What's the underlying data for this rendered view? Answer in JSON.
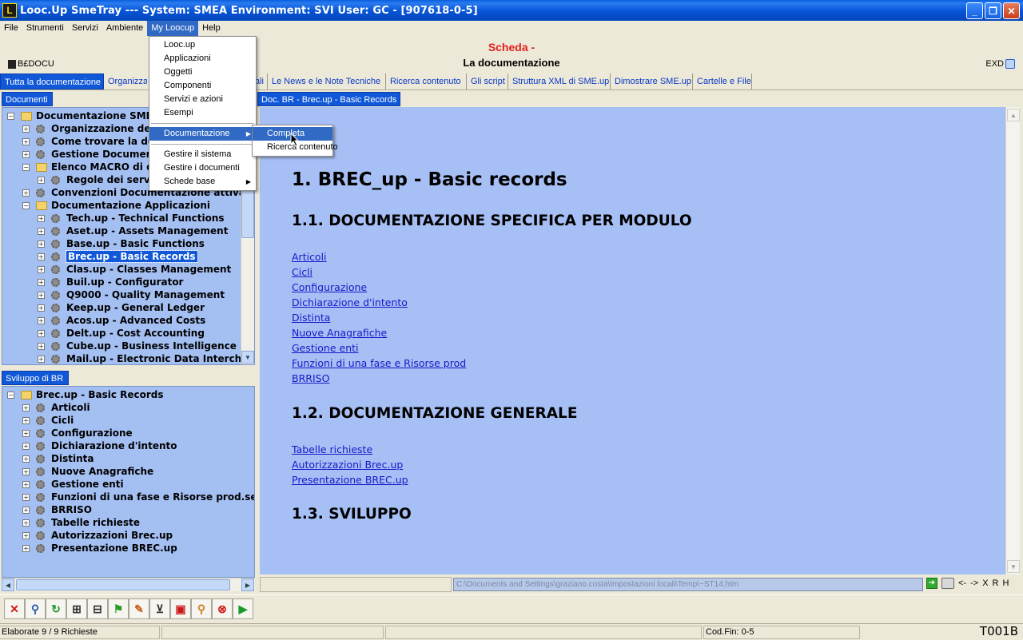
{
  "window": {
    "title": "Looc.Up SmeTray --- System: SMEA Environment: SVI User: GC - [907618-0-5]",
    "app_icon": "L",
    "minimize": "_",
    "restore": "❐",
    "close": "✕"
  },
  "menubar": [
    "File",
    "Strumenti",
    "Servizi",
    "Ambiente",
    "My Loocup",
    "Help"
  ],
  "header": {
    "scheda": "Scheda -",
    "title": "La documentazione",
    "left_code": "B£DOCU",
    "right_code": "EXD"
  },
  "tabs": [
    "Tutta la documentazione",
    "Organizzazione",
    "ali",
    "Le News e le Note Tecniche",
    "Ricerca contenuto",
    "Gli script",
    "Struttura XML di SME.up",
    "Dimostrare SME.up",
    "Cartelle e File"
  ],
  "docs_panel": {
    "tab": "Documenti",
    "items": [
      {
        "label": "Documentazione SME.up",
        "exp": "−",
        "icon": "folder",
        "level": 0
      },
      {
        "label": "Organizzazione della d",
        "exp": "+",
        "icon": "gear",
        "level": 1
      },
      {
        "label": "Come trovare la docu",
        "exp": "+",
        "icon": "gear",
        "level": 1
      },
      {
        "label": "Gestione Documentaz",
        "exp": "+",
        "icon": "gear",
        "level": 1
      },
      {
        "label": "Elenco MACRO di doc",
        "exp": "−",
        "icon": "folder",
        "level": 1
      },
      {
        "label": "Regole dei servizi",
        "exp": "+",
        "icon": "gear",
        "level": 2
      },
      {
        "label": "Convenzioni Documentazione attiva",
        "exp": "+",
        "icon": "gear",
        "level": 1
      },
      {
        "label": "Documentazione Applicazioni",
        "exp": "−",
        "icon": "folder",
        "level": 1
      },
      {
        "label": "Tech.up - Technical Functions",
        "exp": "+",
        "icon": "gear",
        "level": 2
      },
      {
        "label": "Aset.up - Assets Management",
        "exp": "+",
        "icon": "gear",
        "level": 2
      },
      {
        "label": "Base.up - Basic Functions",
        "exp": "+",
        "icon": "gear",
        "level": 2
      },
      {
        "label": "Brec.up - Basic Records",
        "exp": "+",
        "icon": "gear",
        "level": 2,
        "selected": true
      },
      {
        "label": "Clas.up - Classes Management",
        "exp": "+",
        "icon": "gear",
        "level": 2
      },
      {
        "label": "Buil.up - Configurator",
        "exp": "+",
        "icon": "gear",
        "level": 2
      },
      {
        "label": "Q9000 - Quality Management",
        "exp": "+",
        "icon": "gear",
        "level": 2
      },
      {
        "label": "Keep.up - General Ledger",
        "exp": "+",
        "icon": "gear",
        "level": 2
      },
      {
        "label": "Acos.up - Advanced Costs",
        "exp": "+",
        "icon": "gear",
        "level": 2
      },
      {
        "label": "Delt.up - Cost Accounting",
        "exp": "+",
        "icon": "gear",
        "level": 2
      },
      {
        "label": "Cube.up - Business Intelligence",
        "exp": "+",
        "icon": "gear",
        "level": 2
      },
      {
        "label": "Mail.up - Electronic Data Interchange",
        "exp": "+",
        "icon": "gear",
        "level": 2
      }
    ]
  },
  "dev_panel": {
    "tab": "Sviluppo di BR",
    "items": [
      {
        "label": "Brec.up - Basic Records",
        "exp": "−",
        "icon": "folder",
        "level": 0
      },
      {
        "label": "Articoli",
        "exp": "+",
        "icon": "gear",
        "level": 1
      },
      {
        "label": "Cicli",
        "exp": "+",
        "icon": "gear",
        "level": 1
      },
      {
        "label": "Configurazione",
        "exp": "+",
        "icon": "gear",
        "level": 1
      },
      {
        "label": "Dichiarazione d'intento",
        "exp": "+",
        "icon": "gear",
        "level": 1
      },
      {
        "label": "Distinta",
        "exp": "+",
        "icon": "gear",
        "level": 1
      },
      {
        "label": "Nuove Anagrafiche",
        "exp": "+",
        "icon": "gear",
        "level": 1
      },
      {
        "label": "Gestione enti",
        "exp": "+",
        "icon": "gear",
        "level": 1
      },
      {
        "label": "Funzioni di una fase e Risorse prod.secondar",
        "exp": "+",
        "icon": "gear",
        "level": 1
      },
      {
        "label": "BRRISO",
        "exp": "+",
        "icon": "gear",
        "level": 1
      },
      {
        "label": "Tabelle richieste",
        "exp": "+",
        "icon": "gear",
        "level": 1
      },
      {
        "label": "Autorizzazioni Brec.up",
        "exp": "+",
        "icon": "gear",
        "level": 1
      },
      {
        "label": "Presentazione BREC.up",
        "exp": "+",
        "icon": "gear",
        "level": 1
      }
    ]
  },
  "doc": {
    "tab": "Doc. BR - Brec.up - Basic Records",
    "h1": "1.  BREC_up - Basic records",
    "s1": "1.1.  DOCUMENTAZIONE SPECIFICA PER MODULO",
    "links1": [
      "Articoli",
      "Cicli",
      "Configurazione",
      "Dichiarazione d'intento",
      "Distinta",
      "Nuove Anagrafiche",
      "Gestione enti",
      "Funzioni di una fase e Risorse prod",
      "BRRISO"
    ],
    "s2": "1.2.  DOCUMENTAZIONE GENERALE",
    "links2": [
      "Tabelle richieste",
      "Autorizzazioni Brec.up",
      "Presentazione BREC.up"
    ],
    "s3": "1.3.  SVILUPPO"
  },
  "address": {
    "path": "C:\\Documents and Settings\\graziano.costa\\Impostazioni locali\\Temp\\~ST14.htm",
    "nav": [
      "<-",
      "->",
      "X",
      "R",
      "H"
    ]
  },
  "toolbar_icons": [
    "close-red-icon",
    "search-icon",
    "refresh-icon",
    "tree-icon",
    "print-layout-icon",
    "flag-icon",
    "edit-icon",
    "cart-icon",
    "image-icon",
    "magnifier-icon",
    "stop-icon",
    "play-icon"
  ],
  "status": {
    "left": "Elaborate 9 / 9 Richieste",
    "codfin": "Cod.Fin: 0-5",
    "code": "T001B"
  },
  "myloocup_menu": {
    "items": [
      "Looc.up",
      "Applicazioni",
      "Oggetti",
      "Componenti",
      "Servizi e azioni",
      "Esempi"
    ],
    "highlighted": "Documentazione",
    "items2": [
      "Gestire il sistema",
      "Gestire i documenti",
      "Schede base"
    ]
  },
  "submenu": [
    "Completa",
    "Ricerca contenuto"
  ],
  "colors": {
    "accent": "#1058d8",
    "content_bg": "#a6bff4",
    "scheda": "#e0201c",
    "link": "#1818c8"
  }
}
